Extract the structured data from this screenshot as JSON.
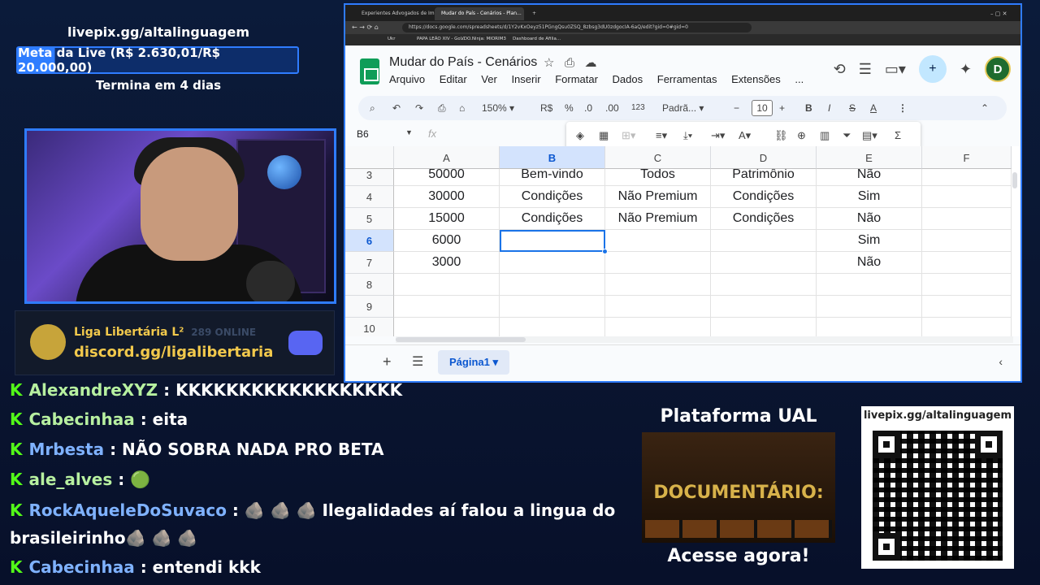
{
  "overlay": {
    "livepix_top": "livepix.gg/altalinguagem",
    "goal": "Meta da Live (R$ 2.630,01/R$ 20.000,00)",
    "goal_progress": 0.1315,
    "ends": "Termina em 4 dias",
    "discord_logo": "LIGA LIBERTÁRIA",
    "discord_server": "Liga Libertária L²",
    "discord_online": "289 ONLINE",
    "discord_link": "discord.gg/ligalibertaria",
    "platform_title": "Plataforma UAL",
    "platform_image_text": "DOCUMENTÁRIO:",
    "platform_cta": "Acesse agora!",
    "qr_label": "livepix.gg/altalinguagem"
  },
  "chat": [
    {
      "user": "AlexandreXYZ",
      "text": "KKKKKKKKKKKKKKKKKK"
    },
    {
      "user": "Cabecinhaa",
      "text": "eita"
    },
    {
      "user": "Mrbesta",
      "text": "NÃO SOBRA NADA PRO BETA"
    },
    {
      "user": "ale_alves",
      "text": "🟢"
    },
    {
      "user": "RockAqueleDoSuvaco",
      "text": "🪨 🪨 🪨 Ilegalidades aí falou a lingua do"
    },
    {
      "user": "",
      "text": "brasileirinho🪨 🪨 🪨"
    },
    {
      "user": "Cabecinhaa",
      "text": "entendi kkk"
    }
  ],
  "browser": {
    "tabs": [
      "Experientes Advogados de Imigraç...",
      "Mudar do País - Cenários - Plan...",
      "+"
    ],
    "url": "https://docs.google.com/spreadsheets/d/1Y2vKxOeyz51PGngQsu0ZSQ_8zbsg3dU0zdgocIA-6aQ/edit?gid=0#gid=0",
    "bookmarks": [
      "Ukr",
      "PAPA LEÃO XIV - Go...",
      "VDO.Ninja: MIORIM3",
      "Dashboard de Afilia..."
    ]
  },
  "sheets": {
    "title": "Mudar do País - Cenários",
    "menu": [
      "Arquivo",
      "Editar",
      "Ver",
      "Inserir",
      "Formatar",
      "Dados",
      "Ferramentas",
      "Extensões",
      "..."
    ],
    "zoom": "150%",
    "currency": "R$",
    "percent": "%",
    "dec_less": ".0",
    "dec_more": ".00",
    "number_format": "123",
    "font": "Padrã...",
    "font_size": "10",
    "name_box": "B6",
    "fx": "fx",
    "avatar": "D",
    "columns": [
      "A",
      "B",
      "C",
      "D",
      "E",
      "F"
    ],
    "rows": [
      {
        "n": "3",
        "cells": [
          "50000",
          "Bem-vindo",
          "Todos",
          "Patrimônio",
          "Não",
          ""
        ]
      },
      {
        "n": "4",
        "cells": [
          "30000",
          "Condições",
          "Não Premium",
          "Condições",
          "Sim",
          ""
        ]
      },
      {
        "n": "5",
        "cells": [
          "15000",
          "Condições",
          "Não Premium",
          "Condições",
          "Não",
          ""
        ]
      },
      {
        "n": "6",
        "cells": [
          "6000",
          "",
          "",
          "",
          "Sim",
          ""
        ]
      },
      {
        "n": "7",
        "cells": [
          "3000",
          "",
          "",
          "",
          "Não",
          ""
        ]
      },
      {
        "n": "8",
        "cells": [
          "",
          "",
          "",
          "",
          "",
          ""
        ]
      },
      {
        "n": "9",
        "cells": [
          "",
          "",
          "",
          "",
          "",
          ""
        ]
      },
      {
        "n": "10",
        "cells": [
          "",
          "",
          "",
          "",
          "",
          ""
        ]
      }
    ],
    "sheet_tab": "Página1"
  },
  "colors": {
    "accent": "#2f7cff",
    "kick_green": "#53fc18",
    "sheets_green": "#0f9d58",
    "selection": "#1a73e8"
  }
}
